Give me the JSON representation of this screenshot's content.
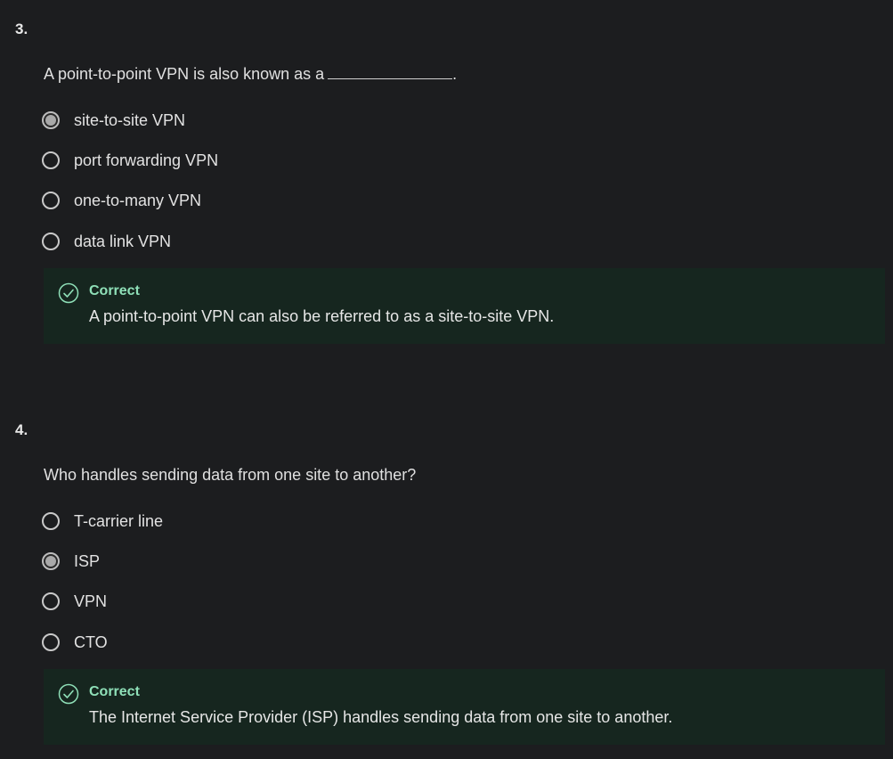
{
  "questions": [
    {
      "number": "3.",
      "prompt": "A point-to-point VPN is also known as a",
      "prompt_suffix": ".",
      "options": [
        {
          "label": "site-to-site VPN",
          "selected": true
        },
        {
          "label": "port forwarding VPN",
          "selected": false
        },
        {
          "label": "one-to-many VPN",
          "selected": false
        },
        {
          "label": "data link VPN",
          "selected": false
        }
      ],
      "feedback": {
        "status": "Correct",
        "icon": "check-circle-icon",
        "text": "A point-to-point VPN can also be referred to as a site-to-site VPN."
      }
    },
    {
      "number": "4.",
      "prompt": "Who handles sending data from one site to another?",
      "options": [
        {
          "label": "T-carrier line",
          "selected": false
        },
        {
          "label": "ISP",
          "selected": true
        },
        {
          "label": "VPN",
          "selected": false
        },
        {
          "label": "CTO",
          "selected": false
        }
      ],
      "feedback": {
        "status": "Correct",
        "icon": "check-circle-icon",
        "text": "The Internet Service Provider (ISP) handles sending data from one site to another."
      }
    }
  ],
  "colors": {
    "background": "#1c1d1f",
    "feedback_background": "#16261f",
    "correct_accent": "#8fe0b8",
    "radio_border": "#c9c9c9"
  }
}
